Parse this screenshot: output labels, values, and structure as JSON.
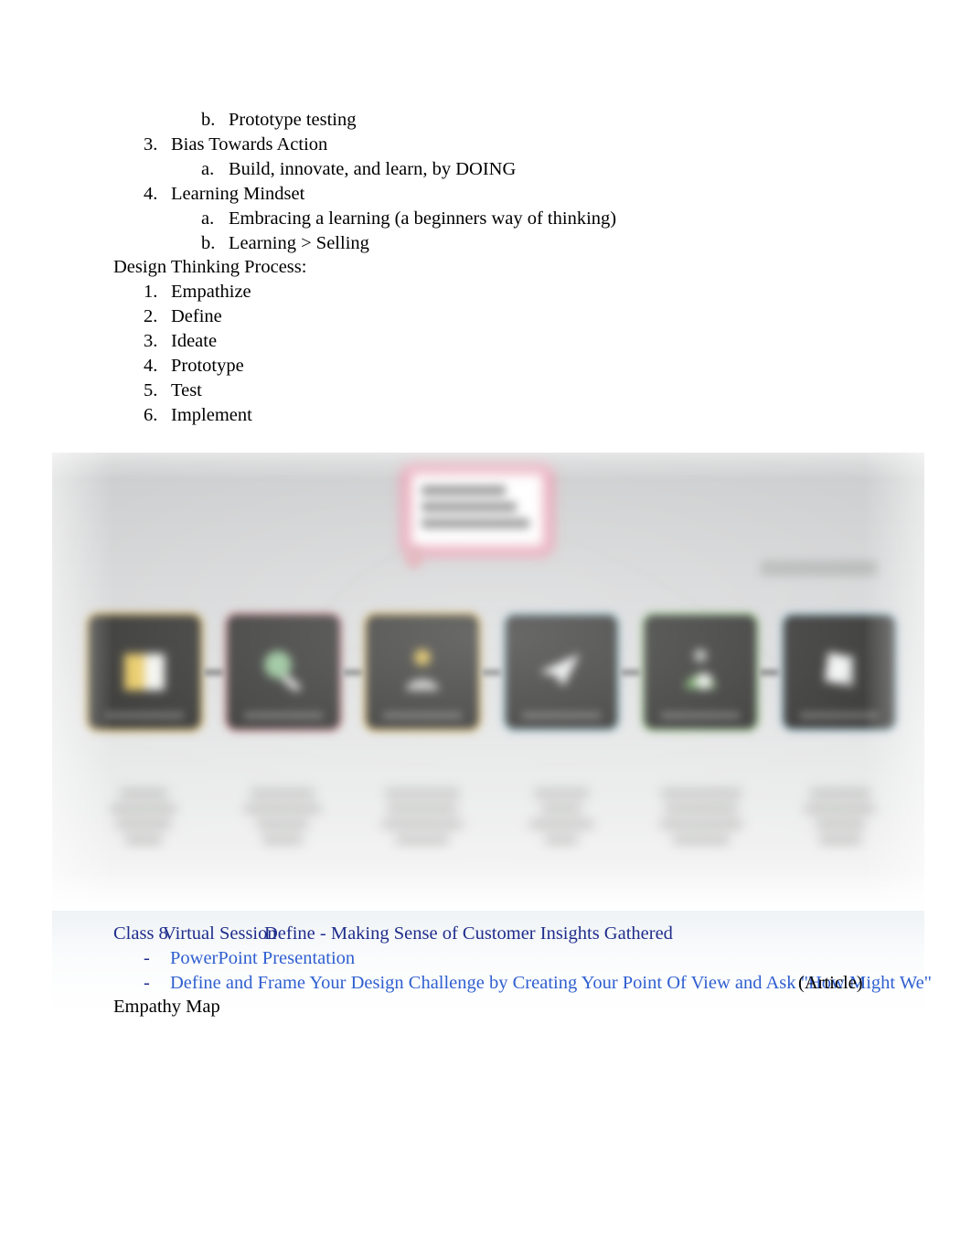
{
  "document": {
    "outline_continued": [
      {
        "level": 2,
        "marker": "b.",
        "text": "Prototype testing"
      },
      {
        "level": 1,
        "marker": "3.",
        "text": "Bias Towards Action"
      },
      {
        "level": 2,
        "marker": "a.",
        "text": "Build, innovate, and learn, by DOING"
      },
      {
        "level": 1,
        "marker": "4.",
        "text": "Learning Mindset"
      },
      {
        "level": 2,
        "marker": "a.",
        "text": "Embracing a learning (a beginners way of thinking)"
      },
      {
        "level": 2,
        "marker": "b.",
        "text": "Learning > Selling"
      }
    ],
    "process_heading": "Design Thinking Process:",
    "process_steps": [
      {
        "marker": "1.",
        "text": "Empathize"
      },
      {
        "marker": "2.",
        "text": "Define"
      },
      {
        "marker": "3.",
        "text": "Ideate"
      },
      {
        "marker": "4.",
        "text": "Prototype"
      },
      {
        "marker": "5.",
        "text": "Test"
      },
      {
        "marker": "6.",
        "text": "Implement"
      }
    ],
    "empathy_map_label": "Empathy Map"
  },
  "figure": {
    "alt_name": "design-thinking-process-infographic",
    "description": "Blurred infographic: pink-outlined title card above a row of six dark icon tiles connected by arrows, with faded caption text beneath each tile",
    "tiles": [
      {
        "name": "book-icon",
        "border_color": "#cdb067",
        "glyph_color": "#e8c75c"
      },
      {
        "name": "magnifier-icon",
        "border_color": "#c08a8f",
        "glyph_color": "#8fbf92"
      },
      {
        "name": "person-idea-icon",
        "border_color": "#cdb067",
        "glyph_color": "#d8b84a"
      },
      {
        "name": "paper-plane-icon",
        "border_color": "#9fc0cb",
        "glyph_color": "#e9ecec"
      },
      {
        "name": "person-target-icon",
        "border_color": "#9cc08f",
        "glyph_color": "#6fa95f"
      },
      {
        "name": "flag-icon",
        "border_color": "#a9c6d2",
        "glyph_color": "#f0f1f1"
      }
    ],
    "card_border_color": "#e6a3b4",
    "background_color": "#d6d7d8"
  },
  "links_block": {
    "header": {
      "class_label": "Class 8",
      "session_label": "Virtual Session",
      "topic_label": "Define - Making Sense of Customer Insights Gathered",
      "color": "#1f2d8c"
    },
    "items": [
      {
        "dash": "-",
        "text": "PowerPoint Presentation",
        "color": "#2f5fd0"
      },
      {
        "dash": "-",
        "text": "Define and Frame Your Design Challenge by Creating Your Point Of View and Ask \"How Might We\"",
        "color": "#2f5fd0"
      }
    ],
    "overlay_note": "(Article)"
  }
}
